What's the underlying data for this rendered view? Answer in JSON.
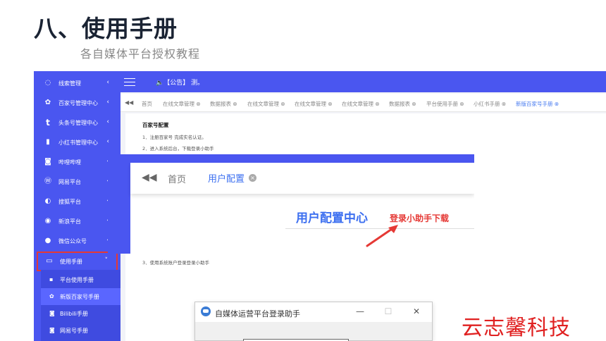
{
  "slide": {
    "title": "八、使用手册",
    "subtitle": "各自媒体平台授权教程",
    "watermark": "云志馨科技"
  },
  "sidebar": {
    "items": [
      {
        "label": "线索管理",
        "icon": "chat-icon",
        "glyph": "◌"
      },
      {
        "label": "百家号管理中心",
        "icon": "paw-icon",
        "glyph": "✿"
      },
      {
        "label": "头条号管理中心",
        "icon": "t-letter-icon",
        "glyph": "t"
      },
      {
        "label": "小红书管理中心",
        "icon": "book-icon",
        "glyph": "▮"
      },
      {
        "label": "哔哩哔哩",
        "icon": "bilibili-icon",
        "glyph": "◙"
      },
      {
        "label": "网易平台",
        "icon": "wordpress-icon",
        "glyph": "Ⓦ"
      },
      {
        "label": "搜狐平台",
        "icon": "sohu-icon",
        "glyph": "◐"
      },
      {
        "label": "新浪平台",
        "icon": "weibo-icon",
        "glyph": "◉"
      },
      {
        "label": "微信公众号",
        "icon": "wechat-icon",
        "glyph": "●"
      }
    ],
    "active_item": {
      "label": "使用手册",
      "icon": "manual-icon",
      "glyph": "▭",
      "chevron": "˅"
    },
    "collapsed_chevron": "‹",
    "submenu": [
      {
        "label": "平台使用手册",
        "icon": "doc-icon",
        "glyph": "▪"
      },
      {
        "label": "新版百家号手册",
        "icon": "paw-icon",
        "glyph": "✿"
      },
      {
        "label": "Bilibili手册",
        "icon": "bilibili-icon",
        "glyph": "◙"
      },
      {
        "label": "网易号手册",
        "icon": "bilibili-icon",
        "glyph": "◙"
      }
    ]
  },
  "topbar": {
    "announcement": "🔈【公告】 测。"
  },
  "tabs": {
    "arrow": "◀◀",
    "items": [
      {
        "label": "首页"
      },
      {
        "label": "在线文章管理 ⊗"
      },
      {
        "label": "数据报表 ⊗"
      },
      {
        "label": "在线文章管理 ⊗"
      },
      {
        "label": "在线文章管理 ⊗"
      },
      {
        "label": "在线文章管理 ⊗"
      },
      {
        "label": "数据报表 ⊗"
      },
      {
        "label": "平台使用手册 ⊗"
      },
      {
        "label": "小红书手册 ⊗"
      },
      {
        "label": "新版百家号手册 ⊗"
      }
    ],
    "active_index": 9,
    "active_color": "#4a7cf0"
  },
  "content": {
    "title": "百家号配置",
    "steps": [
      "1．注册百家号 完成实名认证。",
      "2．进入系统后台，下载登录小助手",
      "3．使用系统账户登录登录小助手"
    ]
  },
  "screenshot": {
    "arrow": "◀◀",
    "home": "首页",
    "tab": "用户配置",
    "tab_close": "×",
    "heading": "用户配置中心",
    "download_link": "登录小助手下载"
  },
  "dialog": {
    "title": "自媒体运营平台登录助手",
    "minimize": "—",
    "maximize": "☐",
    "close": "✕"
  },
  "colors": {
    "brand_blue": "#4a56f0",
    "highlight_red": "#e53935",
    "link_blue": "#3c6ff0"
  }
}
